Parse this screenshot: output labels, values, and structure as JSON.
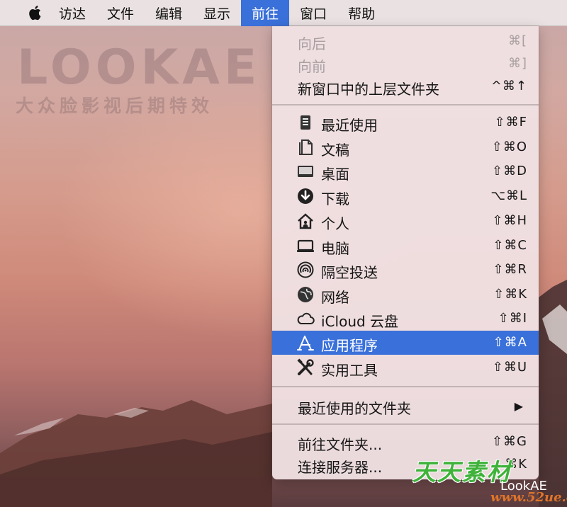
{
  "menubar": {
    "items": [
      {
        "label": "访达"
      },
      {
        "label": "文件"
      },
      {
        "label": "编辑"
      },
      {
        "label": "显示"
      },
      {
        "label": "前往"
      },
      {
        "label": "窗口"
      },
      {
        "label": "帮助"
      }
    ]
  },
  "watermark": {
    "line1": "LOOKAE",
    "line2": "大众脸影视后期特效"
  },
  "menu": {
    "items": [
      {
        "label": "向后",
        "shortcut": "⌘[",
        "disabled": true
      },
      {
        "label": "向前",
        "shortcut": "⌘]",
        "disabled": true
      },
      {
        "label": "新窗口中的上层文件夹",
        "shortcut": "^⌘↑"
      },
      {
        "label": "最近使用",
        "shortcut": "⇧⌘F",
        "icon": "recents-icon"
      },
      {
        "label": "文稿",
        "shortcut": "⇧⌘O",
        "icon": "documents-icon"
      },
      {
        "label": "桌面",
        "shortcut": "⇧⌘D",
        "icon": "desktop-icon"
      },
      {
        "label": "下载",
        "shortcut": "⌥⌘L",
        "icon": "downloads-icon"
      },
      {
        "label": "个人",
        "shortcut": "⇧⌘H",
        "icon": "home-icon"
      },
      {
        "label": "电脑",
        "shortcut": "⇧⌘C",
        "icon": "computer-icon"
      },
      {
        "label": "隔空投送",
        "shortcut": "⇧⌘R",
        "icon": "airdrop-icon"
      },
      {
        "label": "网络",
        "shortcut": "⇧⌘K",
        "icon": "network-icon"
      },
      {
        "label": "iCloud 云盘",
        "shortcut": "⇧⌘I",
        "icon": "icloud-icon"
      },
      {
        "label": "应用程序",
        "shortcut": "⇧⌘A",
        "icon": "applications-icon",
        "selected": true
      },
      {
        "label": "实用工具",
        "shortcut": "⇧⌘U",
        "icon": "utilities-icon"
      },
      {
        "label": "最近使用的文件夹",
        "submenu": true
      },
      {
        "label": "前往文件夹...",
        "shortcut": "⇧⌘G"
      },
      {
        "label": "连接服务器...",
        "shortcut": "⌘K"
      }
    ]
  },
  "stamp": {
    "text": "天天素材",
    "brand": "LookAE",
    "url": "www.52ue.cc"
  }
}
